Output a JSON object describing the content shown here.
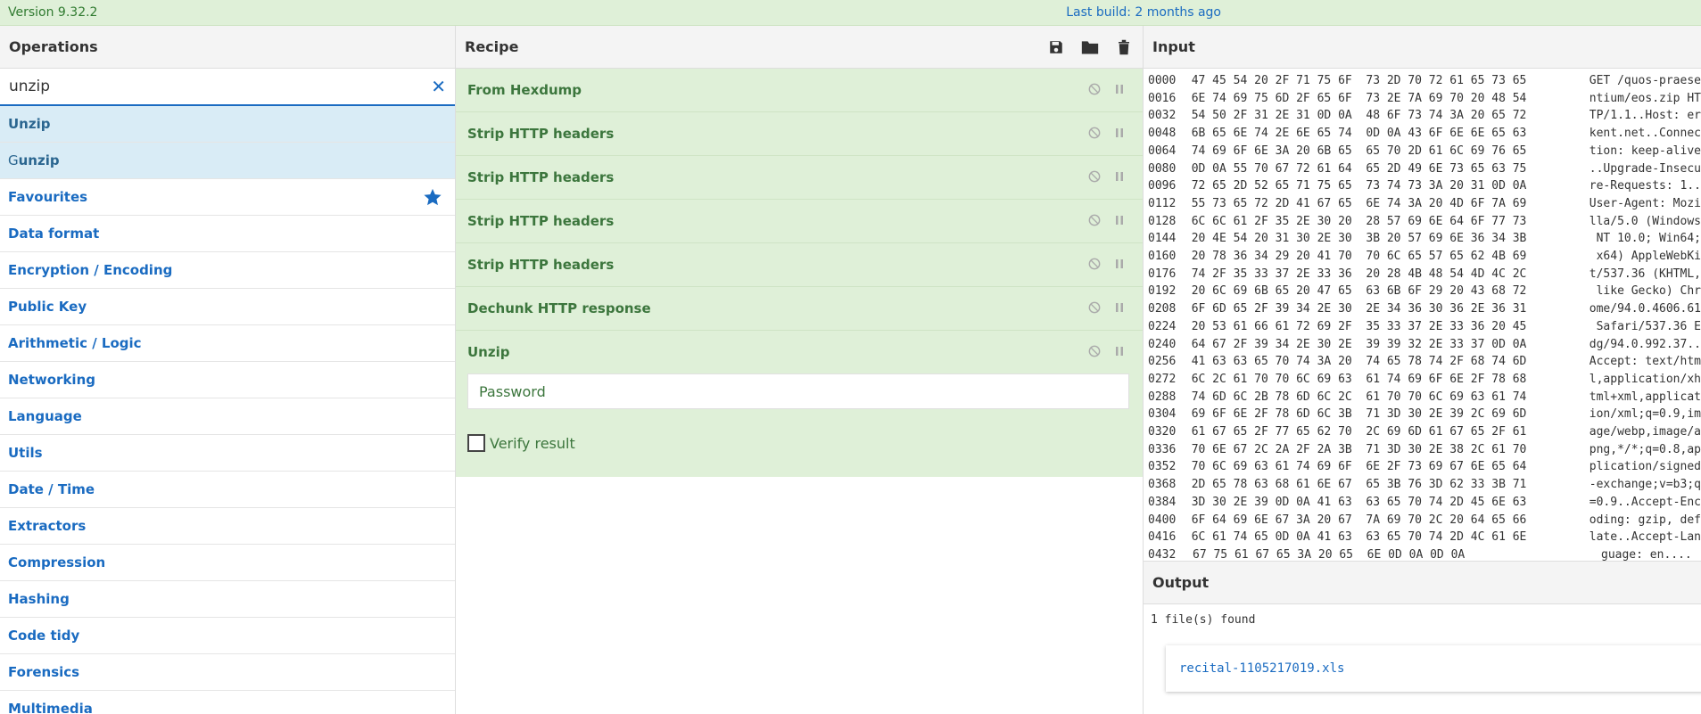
{
  "banner": {
    "version": "Version 9.32.2",
    "last_build": "Last build: 2 months ago"
  },
  "operations": {
    "title": "Operations",
    "search_value": "unzip",
    "results": [
      {
        "hl": "Unzip",
        "rest": ""
      },
      {
        "hl": "G",
        "rest": "unzip"
      }
    ],
    "categories": [
      "Favourites",
      "Data format",
      "Encryption / Encoding",
      "Public Key",
      "Arithmetic / Logic",
      "Networking",
      "Language",
      "Utils",
      "Date / Time",
      "Extractors",
      "Compression",
      "Hashing",
      "Code tidy",
      "Forensics",
      "Multimedia"
    ]
  },
  "recipe": {
    "title": "Recipe",
    "ops": [
      "From Hexdump",
      "Strip HTTP headers",
      "Strip HTTP headers",
      "Strip HTTP headers",
      "Strip HTTP headers",
      "Dechunk HTTP response",
      "Unzip"
    ],
    "password_placeholder": "Password",
    "verify_label": "Verify result"
  },
  "input": {
    "title": "Input",
    "rows": [
      [
        "0000",
        "47 45 54 20 2F 71 75 6F  73 2D 70 72 61 65 73 65",
        "GET /quos-praese"
      ],
      [
        "0016",
        "6E 74 69 75 6D 2F 65 6F  73 2E 7A 69 70 20 48 54",
        "ntium/eos.zip HT"
      ],
      [
        "0032",
        "54 50 2F 31 2E 31 0D 0A  48 6F 73 74 3A 20 65 72",
        "TP/1.1..Host: er"
      ],
      [
        "0048",
        "6B 65 6E 74 2E 6E 65 74  0D 0A 43 6F 6E 6E 65 63",
        "kent.net..Connec"
      ],
      [
        "0064",
        "74 69 6F 6E 3A 20 6B 65  65 70 2D 61 6C 69 76 65",
        "tion: keep-alive"
      ],
      [
        "0080",
        "0D 0A 55 70 67 72 61 64  65 2D 49 6E 73 65 63 75",
        "..Upgrade-Insecu"
      ],
      [
        "0096",
        "72 65 2D 52 65 71 75 65  73 74 73 3A 20 31 0D 0A",
        "re-Requests: 1.."
      ],
      [
        "0112",
        "55 73 65 72 2D 41 67 65  6E 74 3A 20 4D 6F 7A 69",
        "User-Agent: Mozi"
      ],
      [
        "0128",
        "6C 6C 61 2F 35 2E 30 20  28 57 69 6E 64 6F 77 73",
        "lla/5.0 (Windows"
      ],
      [
        "0144",
        "20 4E 54 20 31 30 2E 30  3B 20 57 69 6E 36 34 3B",
        " NT 10.0; Win64;"
      ],
      [
        "0160",
        "20 78 36 34 29 20 41 70  70 6C 65 57 65 62 4B 69",
        " x64) AppleWebKi"
      ],
      [
        "0176",
        "74 2F 35 33 37 2E 33 36  20 28 4B 48 54 4D 4C 2C",
        "t/537.36 (KHTML,"
      ],
      [
        "0192",
        "20 6C 69 6B 65 20 47 65  63 6B 6F 29 20 43 68 72",
        " like Gecko) Chr"
      ],
      [
        "0208",
        "6F 6D 65 2F 39 34 2E 30  2E 34 36 30 36 2E 36 31",
        "ome/94.0.4606.61"
      ],
      [
        "0224",
        "20 53 61 66 61 72 69 2F  35 33 37 2E 33 36 20 45",
        " Safari/537.36 E"
      ],
      [
        "0240",
        "64 67 2F 39 34 2E 30 2E  39 39 32 2E 33 37 0D 0A",
        "dg/94.0.992.37.."
      ],
      [
        "0256",
        "41 63 63 65 70 74 3A 20  74 65 78 74 2F 68 74 6D",
        "Accept: text/htm"
      ],
      [
        "0272",
        "6C 2C 61 70 70 6C 69 63  61 74 69 6F 6E 2F 78 68",
        "l,application/xh"
      ],
      [
        "0288",
        "74 6D 6C 2B 78 6D 6C 2C  61 70 70 6C 69 63 61 74",
        "tml+xml,applicat"
      ],
      [
        "0304",
        "69 6F 6E 2F 78 6D 6C 3B  71 3D 30 2E 39 2C 69 6D",
        "ion/xml;q=0.9,im"
      ],
      [
        "0320",
        "61 67 65 2F 77 65 62 70  2C 69 6D 61 67 65 2F 61",
        "age/webp,image/a"
      ],
      [
        "0336",
        "70 6E 67 2C 2A 2F 2A 3B  71 3D 30 2E 38 2C 61 70",
        "png,*/*;q=0.8,ap"
      ],
      [
        "0352",
        "70 6C 69 63 61 74 69 6F  6E 2F 73 69 67 6E 65 64",
        "plication/signed"
      ],
      [
        "0368",
        "2D 65 78 63 68 61 6E 67  65 3B 76 3D 62 33 3B 71",
        "-exchange;v=b3;q"
      ],
      [
        "0384",
        "3D 30 2E 39 0D 0A 41 63  63 65 70 74 2D 45 6E 63",
        "=0.9..Accept-Enc"
      ],
      [
        "0400",
        "6F 64 69 6E 67 3A 20 67  7A 69 70 2C 20 64 65 66",
        "oding: gzip, def"
      ],
      [
        "0416",
        "6C 61 74 65 0D 0A 41 63  63 65 70 74 2D 4C 61 6E",
        "late..Accept-Lan"
      ],
      [
        "0432",
        "67 75 61 67 65 3A 20 65  6E 0D 0A 0D 0A",
        "guage: en...."
      ]
    ]
  },
  "output": {
    "title": "Output",
    "status": "1 file(s) found",
    "file_name": "recital-1105217019.xls"
  },
  "colors": {
    "accent": "#1a6bc1",
    "recipe_bg": "#dff0d8",
    "recipe_text": "#3c763d"
  }
}
